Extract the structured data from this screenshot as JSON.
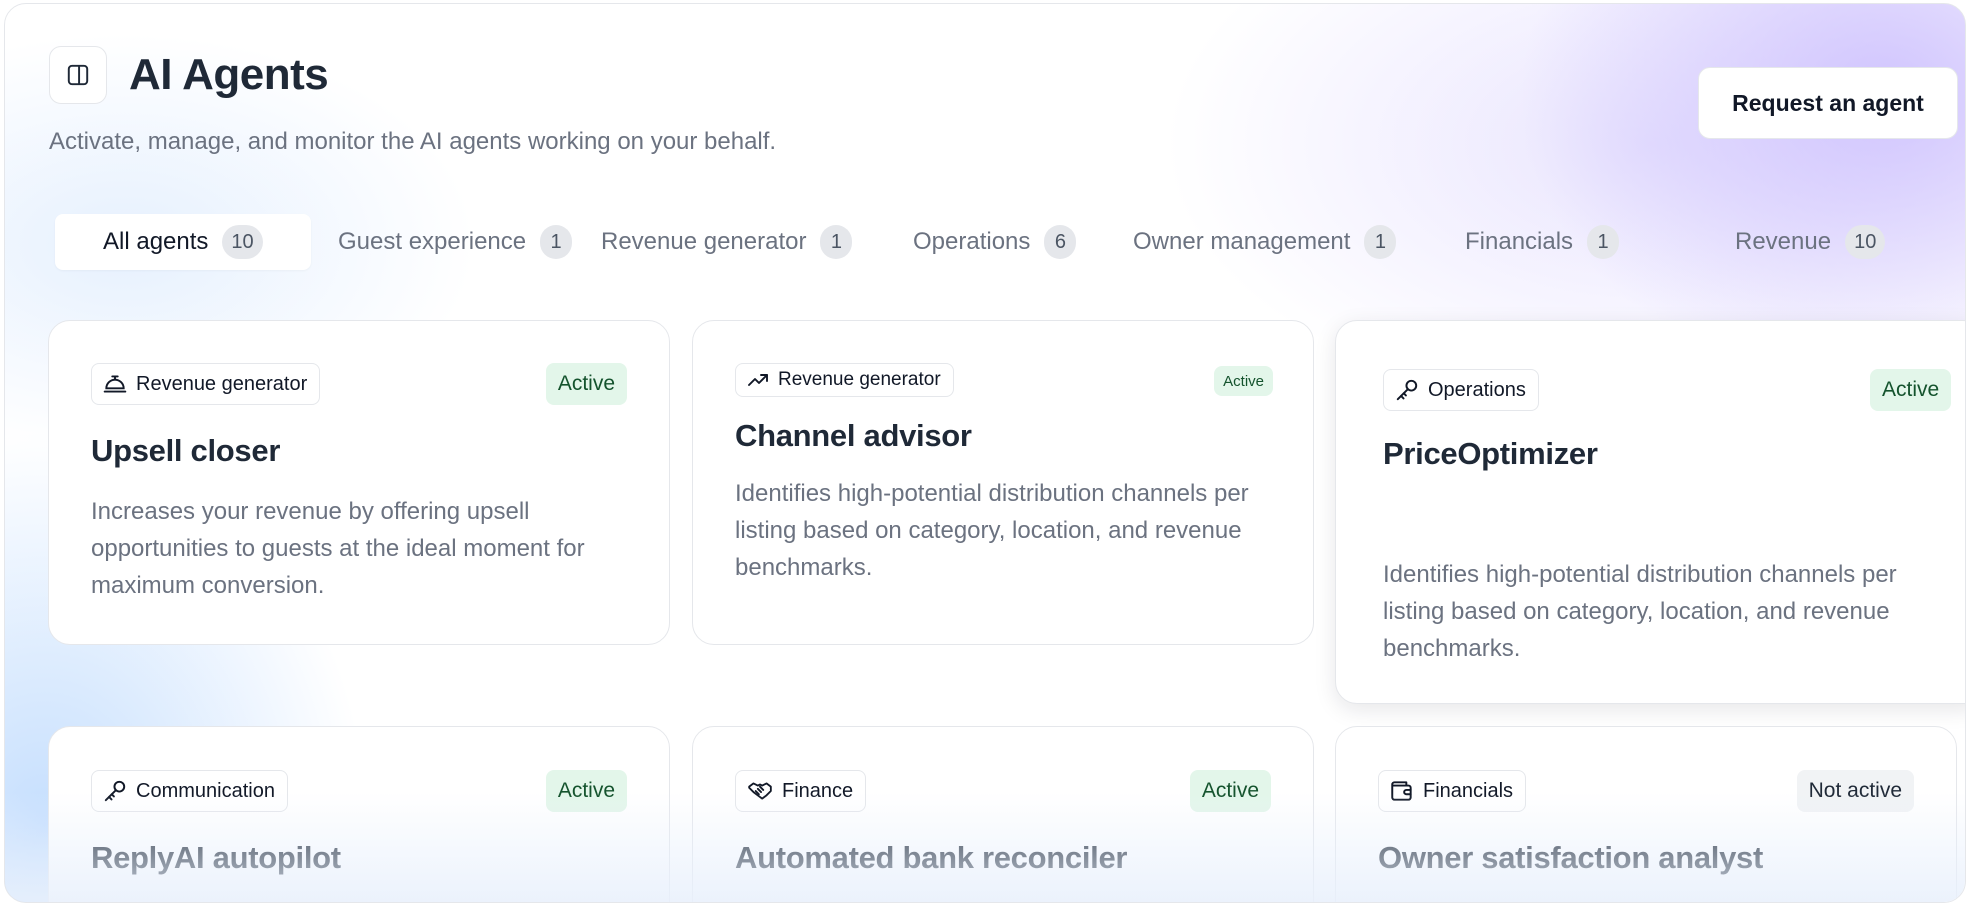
{
  "header": {
    "title": "AI Agents",
    "subtitle": "Activate, manage, and monitor the AI agents working on your behalf.",
    "request_button": "Request an agent",
    "sidebar_toggle_icon": "sidebar-panel-icon"
  },
  "tabs": [
    {
      "label": "All agents",
      "count": "10",
      "active": true
    },
    {
      "label": "Guest experience",
      "count": "1"
    },
    {
      "label": "Revenue generator",
      "count": "1"
    },
    {
      "label": "Operations",
      "count": "6"
    },
    {
      "label": "Owner management",
      "count": "1"
    },
    {
      "label": "Financials",
      "count": "1"
    },
    {
      "label": "Revenue",
      "count": "10"
    }
  ],
  "cards": [
    {
      "category": "Revenue generator",
      "icon": "concierge-bell-icon",
      "status": "Active",
      "title": "Upsell closer",
      "description": "Increases your revenue by offering upsell opportunities to guests at the ideal moment for maximum conversion."
    },
    {
      "category": "Revenue generator",
      "icon": "trending-up-icon",
      "status": "Active",
      "title": "Channel advisor",
      "description": "Identifies high-potential distribution channels per listing based on category, location, and revenue benchmarks."
    },
    {
      "category": "Operations",
      "icon": "key-icon",
      "status": "Active",
      "title": "PriceOptimizer",
      "description": "Identifies high-potential distribution channels per listing based on category, location, and revenue benchmarks."
    },
    {
      "category": "Communication",
      "icon": "key-icon",
      "status": "Active",
      "title": "ReplyAI autopilot",
      "description": ""
    },
    {
      "category": "Finance",
      "icon": "handshake-icon",
      "status": "Active",
      "title": "Automated bank reconciler",
      "description": ""
    },
    {
      "category": "Financials",
      "icon": "wallet-icon",
      "status": "Not active",
      "title": "Owner satisfaction analyst",
      "description": ""
    }
  ],
  "colors": {
    "active_badge_bg": "#e3f6ea",
    "inactive_badge_bg": "#f1f3f5",
    "accent_purple": "#c4b5fd",
    "accent_blue": "#bfdbfe"
  }
}
